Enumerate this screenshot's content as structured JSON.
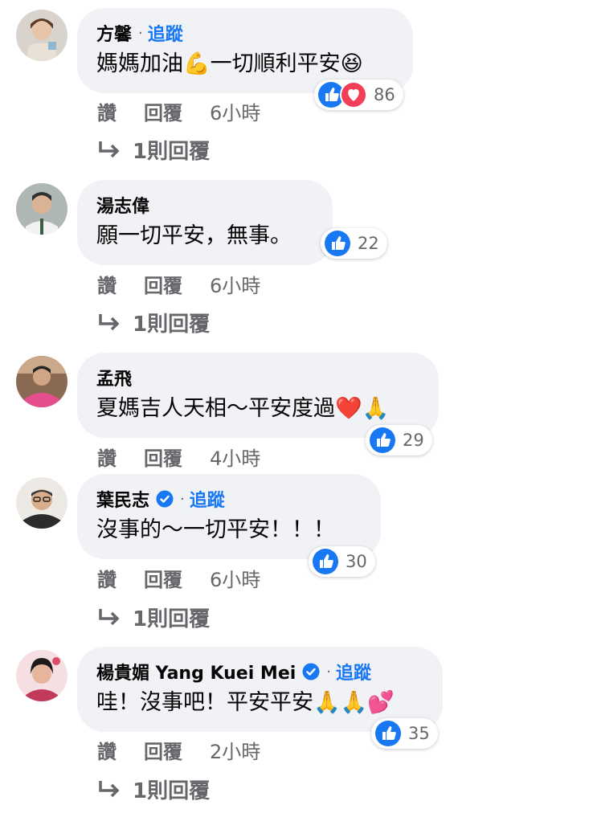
{
  "labels": {
    "like": "讚",
    "reply": "回覆",
    "follow": "追蹤",
    "dot": "·"
  },
  "comments": [
    {
      "name": "方馨",
      "text": "媽媽加油💪一切順利平安😆",
      "reactions": "86",
      "time": "6小時",
      "replies": "1則回覆",
      "follow": true,
      "verified": false
    },
    {
      "name": "湯志偉",
      "text": "願一切平安，無事。",
      "reactions": "22",
      "time": "6小時",
      "replies": "1則回覆",
      "follow": false,
      "verified": false
    },
    {
      "name": "孟飛",
      "text": "夏媽吉人天相～平安度過❤️🙏",
      "reactions": "29",
      "time": "4小時",
      "replies": "",
      "follow": false,
      "verified": false
    },
    {
      "name": "葉民志",
      "text": "沒事的～一切平安！！！",
      "reactions": "30",
      "time": "6小時",
      "replies": "1則回覆",
      "follow": true,
      "verified": true
    },
    {
      "name": "楊貴媚 Yang Kuei Mei",
      "text": "哇！沒事吧！平安平安🙏🙏💕",
      "reactions": "35",
      "time": "2小時",
      "replies": "1則回覆",
      "follow": true,
      "verified": true
    }
  ],
  "colors": {
    "link": "#1877f2",
    "bubble": "#f0f2f5",
    "muted": "#65676b",
    "like_blue": "#1877f2",
    "love_red": "#f33e58"
  },
  "icons": [
    "like-reaction-icon",
    "love-reaction-icon",
    "verified-badge-icon",
    "reply-arrow-icon"
  ]
}
